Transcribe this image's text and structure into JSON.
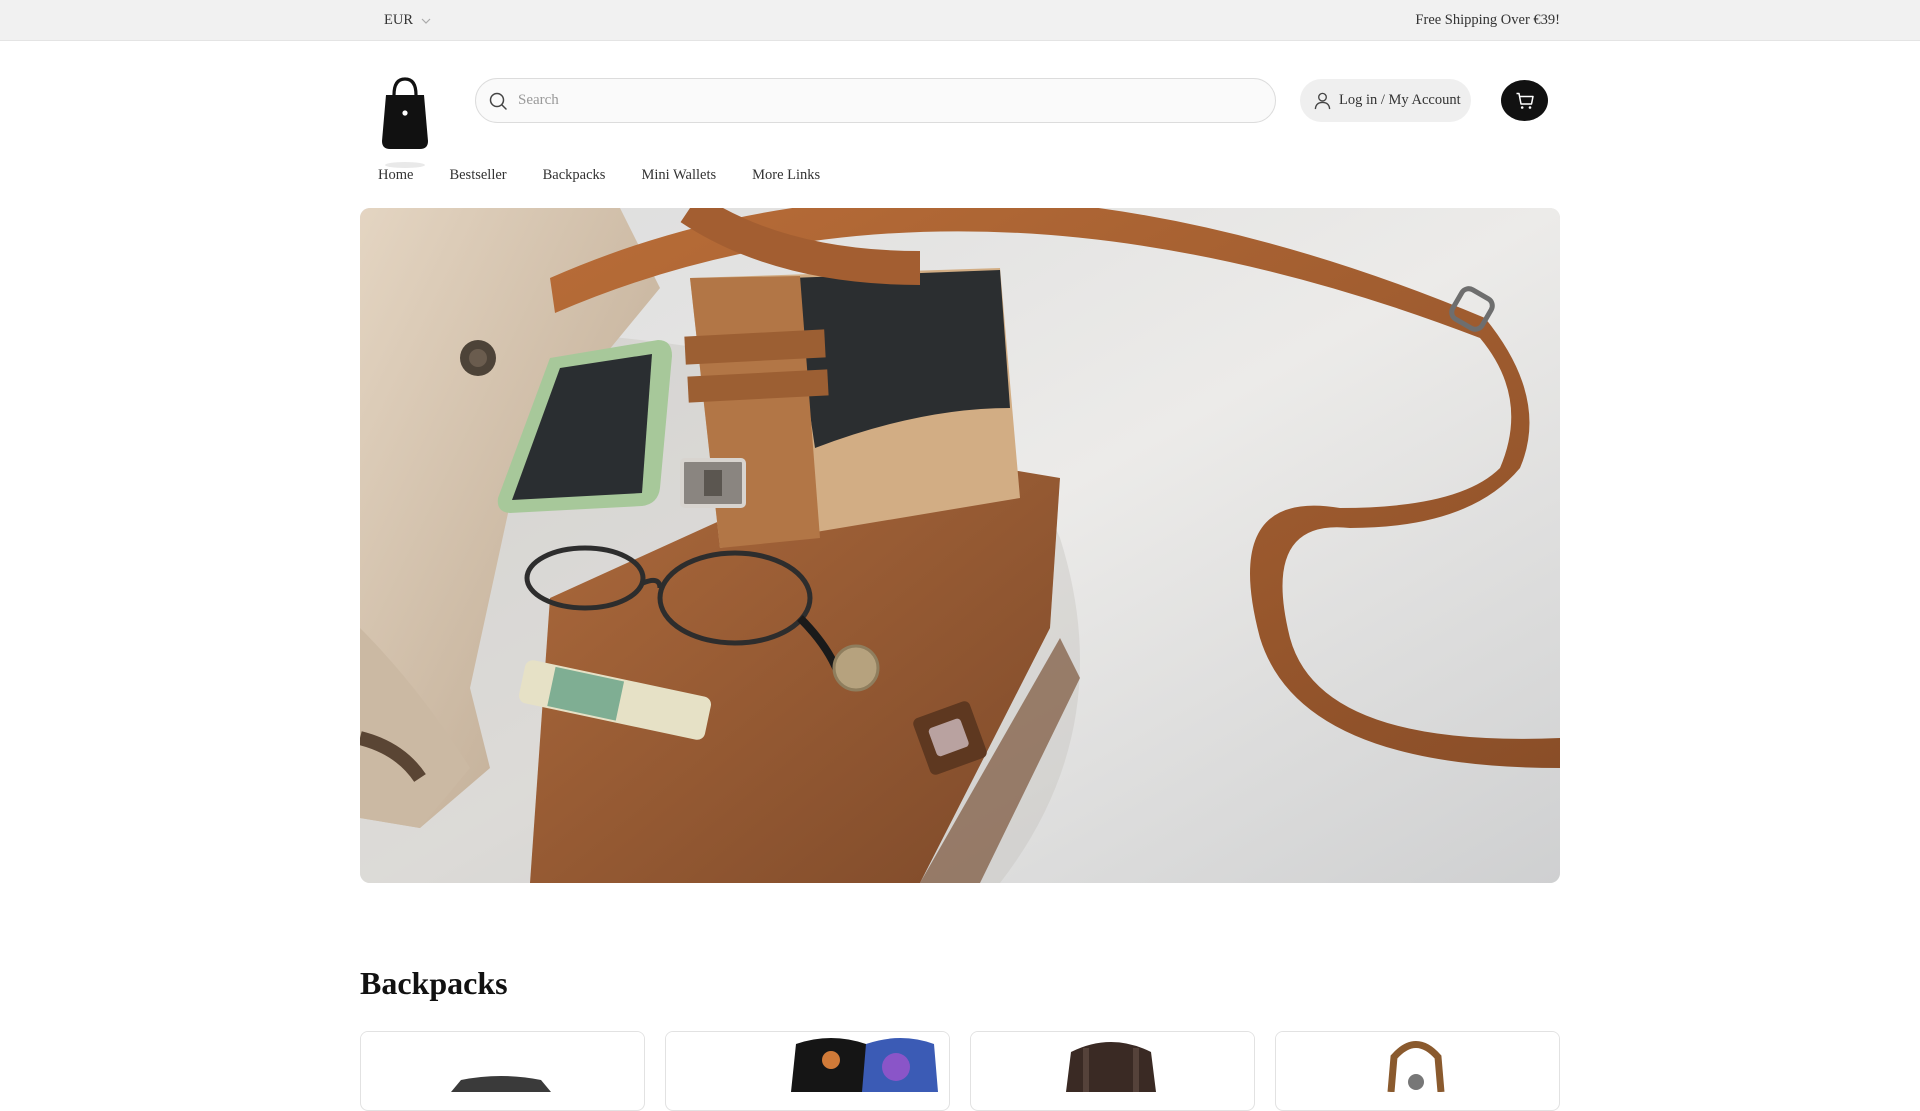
{
  "topbar": {
    "currency": "EUR",
    "announcement": "Free Shipping Over €39!"
  },
  "header": {
    "logo_icon": "handbag-logo-icon",
    "search_placeholder": "Search",
    "account_label": "Log in / My Account",
    "cart_icon": "cart-icon"
  },
  "nav": {
    "items": [
      "Home",
      "Bestseller",
      "Backpacks",
      "Mini Wallets",
      "More Links"
    ]
  },
  "section": {
    "title": "Backpacks"
  },
  "colors": {
    "topbar_bg": "#f1f1f1",
    "cart_bg": "#111111",
    "leather": "#a86232",
    "wallet_dark": "#2a2d2f"
  }
}
